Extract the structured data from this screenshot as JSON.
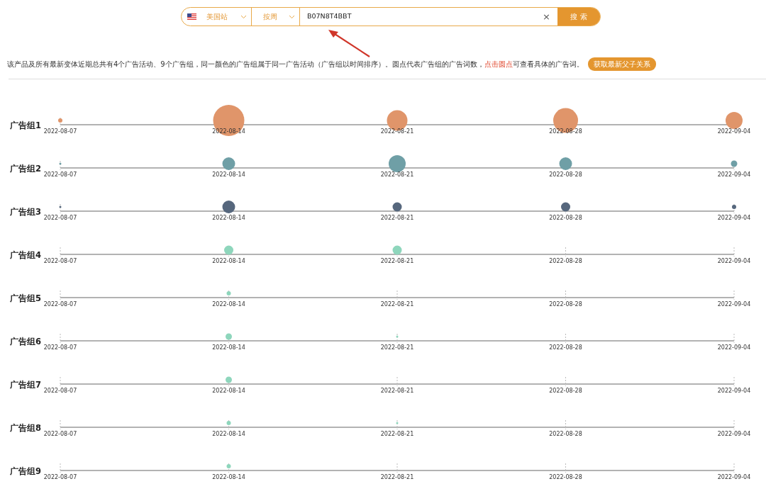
{
  "search_bar": {
    "site": "美国站",
    "period": "按周",
    "query": "B07N8T4BBT",
    "clear": "×",
    "button": "搜 索"
  },
  "summary": {
    "text_before": "该产品及所有最新变体近期总共有4个广告活动、9个广告组，同一颜色的广告组属于同一广告活动（广告组以时间排序）。圆点代表广告组的广告词数，",
    "link": "点击圆点",
    "text_after": "可查看具体的广告词。",
    "button": "获取最新父子关系"
  },
  "groups": [
    {
      "label": "广告组1",
      "color": "#e0956a",
      "points": [
        {
          "date": "2022-08-07",
          "kind": "xs"
        },
        {
          "date": "2022-08-14",
          "kind": "huge"
        },
        {
          "date": "2022-08-21",
          "kind": "xxl"
        },
        {
          "date": "2022-08-28",
          "kind": "x3"
        },
        {
          "date": "2022-09-04",
          "kind": "xl"
        }
      ]
    },
    {
      "label": "广告组2",
      "color": "#6f9fa6",
      "points": [
        {
          "date": "2022-08-07",
          "kind": "tiny"
        },
        {
          "date": "2022-08-14",
          "kind": "lg"
        },
        {
          "date": "2022-08-21",
          "kind": "xl"
        },
        {
          "date": "2022-08-28",
          "kind": "lg"
        },
        {
          "date": "2022-09-04",
          "kind": "sm"
        }
      ]
    },
    {
      "label": "广告组3",
      "color": "#56677d",
      "points": [
        {
          "date": "2022-08-07",
          "kind": "tiny"
        },
        {
          "date": "2022-08-14",
          "kind": "lg"
        },
        {
          "date": "2022-08-21",
          "kind": "md"
        },
        {
          "date": "2022-08-28",
          "kind": "md"
        },
        {
          "date": "2022-09-04",
          "kind": "xs"
        }
      ]
    },
    {
      "label": "广告组4",
      "color": "#8ed6bc",
      "points": [
        {
          "date": "2022-08-07",
          "kind": "none"
        },
        {
          "date": "2022-08-14",
          "kind": "md"
        },
        {
          "date": "2022-08-21",
          "kind": "md"
        },
        {
          "date": "2022-08-28",
          "kind": "none"
        },
        {
          "date": "2022-09-04",
          "kind": "none"
        }
      ]
    },
    {
      "label": "广告组5",
      "color": "#8ed6bc",
      "points": [
        {
          "date": "2022-08-07",
          "kind": "none"
        },
        {
          "date": "2022-08-14",
          "kind": "xs"
        },
        {
          "date": "2022-08-21",
          "kind": "none"
        },
        {
          "date": "2022-08-28",
          "kind": "none"
        },
        {
          "date": "2022-09-04",
          "kind": "none"
        }
      ]
    },
    {
      "label": "广告组6",
      "color": "#8ed6bc",
      "points": [
        {
          "date": "2022-08-07",
          "kind": "none"
        },
        {
          "date": "2022-08-14",
          "kind": "sm"
        },
        {
          "date": "2022-08-21",
          "kind": "tiny"
        },
        {
          "date": "2022-08-28",
          "kind": "none"
        },
        {
          "date": "2022-09-04",
          "kind": "none"
        }
      ]
    },
    {
      "label": "广告组7",
      "color": "#8ed6bc",
      "points": [
        {
          "date": "2022-08-07",
          "kind": "none"
        },
        {
          "date": "2022-08-14",
          "kind": "sm"
        },
        {
          "date": "2022-08-21",
          "kind": "none"
        },
        {
          "date": "2022-08-28",
          "kind": "none"
        },
        {
          "date": "2022-09-04",
          "kind": "none"
        }
      ]
    },
    {
      "label": "广告组8",
      "color": "#8ed6bc",
      "points": [
        {
          "date": "2022-08-07",
          "kind": "none"
        },
        {
          "date": "2022-08-14",
          "kind": "xs"
        },
        {
          "date": "2022-08-21",
          "kind": "tiny"
        },
        {
          "date": "2022-08-28",
          "kind": "none"
        },
        {
          "date": "2022-09-04",
          "kind": "none"
        }
      ]
    },
    {
      "label": "广告组9",
      "color": "#8ed6bc",
      "points": [
        {
          "date": "2022-08-07",
          "kind": "none"
        },
        {
          "date": "2022-08-14",
          "kind": "xs"
        },
        {
          "date": "2022-08-21",
          "kind": "none"
        },
        {
          "date": "2022-08-28",
          "kind": "none"
        },
        {
          "date": "2022-09-04",
          "kind": "none"
        }
      ]
    }
  ]
}
